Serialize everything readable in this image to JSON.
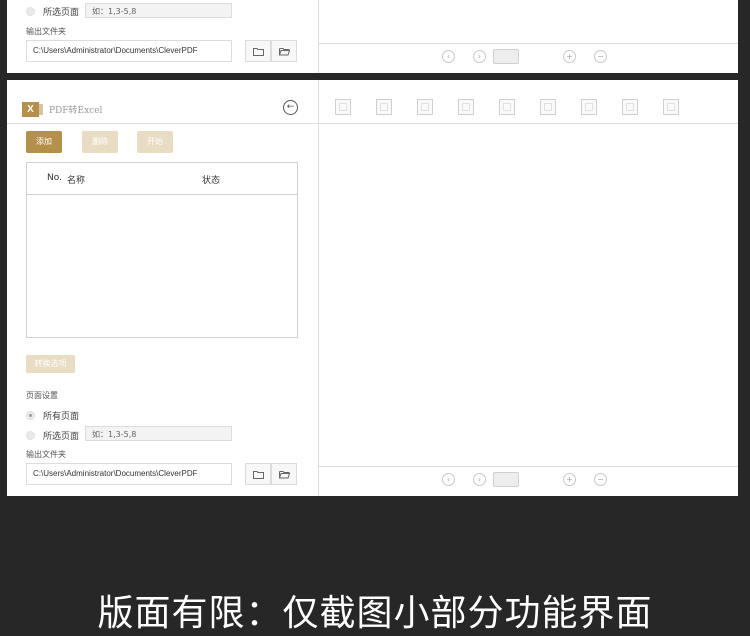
{
  "top_window": {
    "selected_pages_label": "所选页面",
    "page_input_value": "如：1,3-5,8",
    "output_folder_label": "输出文件夹",
    "output_path": "C:\\Users\\Administrator\\Documents\\CleverPDF"
  },
  "main_window": {
    "logo_text": "X",
    "app_title": "PDF转Excel",
    "buttons": {
      "add": "添加",
      "delete": "删除",
      "start": "开始"
    },
    "table": {
      "col_no": "No.",
      "col_name": "名称",
      "col_status": "状态"
    },
    "convert_options": "转换选项",
    "page_settings_label": "页面设置",
    "all_pages_label": "所有页面",
    "selected_pages_label": "所选页面",
    "page_input_value": "如：1,3-5,8",
    "output_folder_label": "输出文件夹",
    "output_path": "C:\\Users\\Administrator\\Documents\\CleverPDF",
    "toolbar_icons": [
      "zoom-icon",
      "select-area-icon",
      "image-select-icon",
      "add-table-icon",
      "single-cell-icon",
      "vertical-split-icon",
      "add-row-icon",
      "table-grid-icon",
      "table-grid-alt-icon"
    ]
  },
  "caption": "版面有限：仅截图小部分功能界面",
  "colors": {
    "accent": "#b4904a",
    "accent_disabled": "#e8dcc2",
    "background": "#272727"
  }
}
